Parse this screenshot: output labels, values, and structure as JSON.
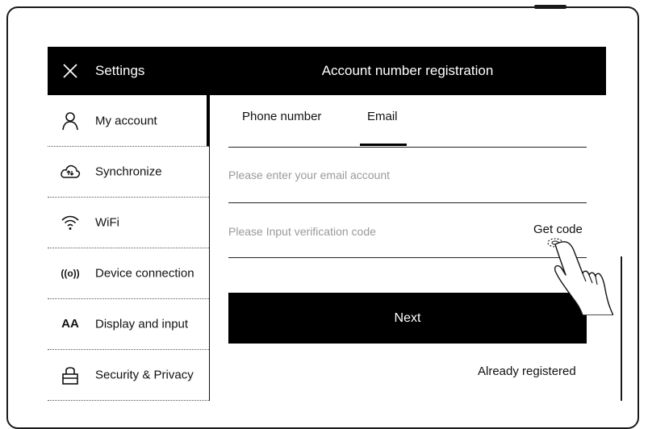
{
  "header": {
    "settings_title": "Settings",
    "page_title": "Account number registration"
  },
  "sidebar": {
    "items": [
      {
        "label": "My account",
        "icon": "person-icon",
        "active": true
      },
      {
        "label": "Synchronize",
        "icon": "cloud-sync-icon"
      },
      {
        "label": "WiFi",
        "icon": "wifi-icon"
      },
      {
        "label": "Device connection",
        "icon": "device-connection-icon",
        "icon_text": "((o))"
      },
      {
        "label": "Display and input",
        "icon": "font-size-icon",
        "icon_text": "AA"
      },
      {
        "label": "Security & Privacy",
        "icon": "lock-icon"
      }
    ]
  },
  "tabs": [
    {
      "label": "Phone number"
    },
    {
      "label": "Email",
      "selected": true
    }
  ],
  "form": {
    "email_placeholder": "Please enter your email account",
    "code_placeholder": "Please Input verification code",
    "get_code_label": "Get code",
    "next_label": "Next",
    "already_registered_label": "Already registered"
  },
  "colors": {
    "topbar": "#000000",
    "button": "#000000",
    "placeholder": "#9a9a9a"
  }
}
